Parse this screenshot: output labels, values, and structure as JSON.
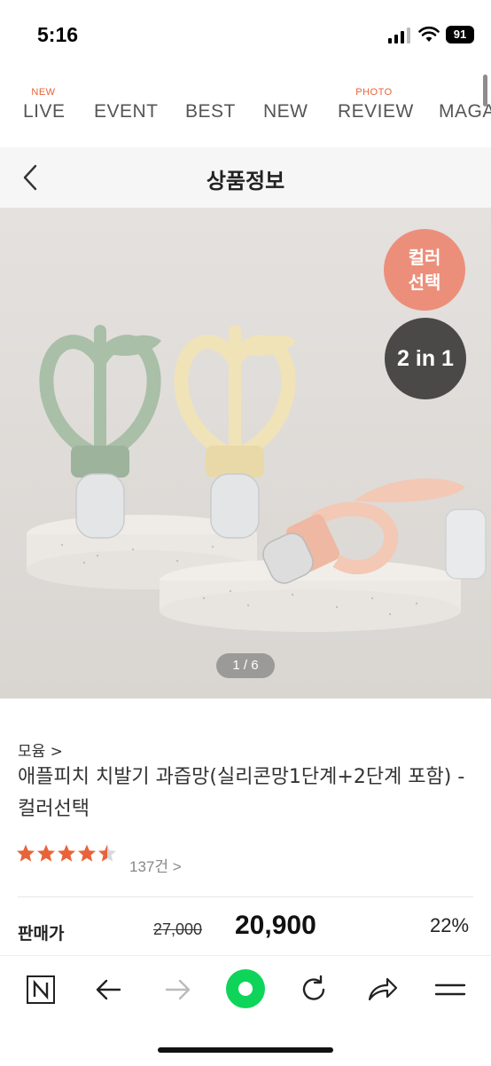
{
  "status_bar": {
    "time": "5:16",
    "battery": "91"
  },
  "top_nav": [
    {
      "label": "LIVE",
      "sup": "NEW"
    },
    {
      "label": "EVENT",
      "sup": ""
    },
    {
      "label": "BEST",
      "sup": ""
    },
    {
      "label": "NEW",
      "sup": ""
    },
    {
      "label": "REVIEW",
      "sup": "PHOTO"
    },
    {
      "label": "MAGA",
      "sup": ""
    }
  ],
  "header": {
    "title": "상품정보"
  },
  "hero": {
    "badge_color": [
      "컬러",
      "선택"
    ],
    "badge_2in1": "2 in 1",
    "pager": "1 / 6"
  },
  "product": {
    "breadcrumb": "모윰 >",
    "title": "애플피치 치발기 과즙망(실리콘망1단계+2단계 포함) - 컬러선택",
    "rating": 4.5,
    "review_count": "137건 >",
    "price_label": "판매가",
    "original_price": "27,000",
    "sale_price": "20,900",
    "discount": "22%"
  },
  "colors": {
    "accent": "#e8633a",
    "badge_color": "#ec8f7a",
    "badge_dark": "#4a4948",
    "star": "#e8633a"
  }
}
